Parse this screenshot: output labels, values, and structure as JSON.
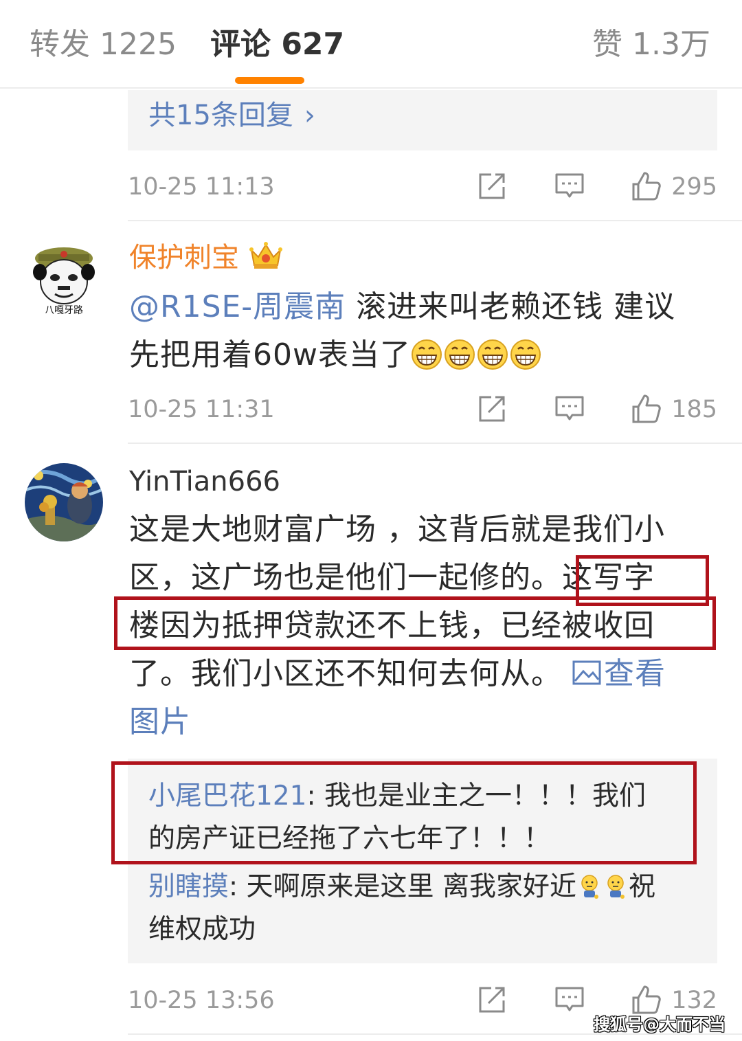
{
  "tabs": {
    "forward": "转发 1225",
    "comments": "评论 627",
    "likes": "赞 1.3万"
  },
  "thread1": {
    "more_replies": "共15条回复",
    "more_replies_chevron": "›",
    "time": "10-25 11:13",
    "likes": "295"
  },
  "comment2": {
    "avatar_icon": "panda-meme-avatar",
    "username": "保护刺宝",
    "badge_icon": "crown-badge-icon",
    "mention": "@R1SE-周震南",
    "text_line1": " 滚进来叫老赖还钱 建议",
    "text_line2": "先把用着60w表当了",
    "emoji": "grin-emoji",
    "time": "10-25 11:31",
    "likes": "185"
  },
  "comment3": {
    "avatar_icon": "starry-night-avatar",
    "username": "YinTian666",
    "line1": "这是大地财富广场 ，这背后就是我们小",
    "line2": "区，这广场也是他们一起修的。这写字",
    "line3": "楼因为抵押贷款还不上钱，已经被收回",
    "line4_text": "了。我们小区还不知何去何从。",
    "line4_link": "查看",
    "line5_link": "图片",
    "replies": [
      {
        "user": "小尾巴花121",
        "line1": ": 我也是业主之一！！！我们",
        "line2": "的房产证已经拖了六七年了！！！"
      },
      {
        "user": "别瞎摸",
        "line1": ": 天啊原来是这里 离我家好近",
        "line1_tail": "祝",
        "line2": "维权成功"
      }
    ],
    "time": "10-25 13:56",
    "likes": "132"
  },
  "watermark": "搜狐号@大而不当",
  "colors": {
    "accent_orange": "#ff8200",
    "link_blue": "#5c7fbb",
    "vip_orange": "#f0832a",
    "highlight_red": "#b0121b",
    "reply_bg": "#f4f4f4"
  }
}
